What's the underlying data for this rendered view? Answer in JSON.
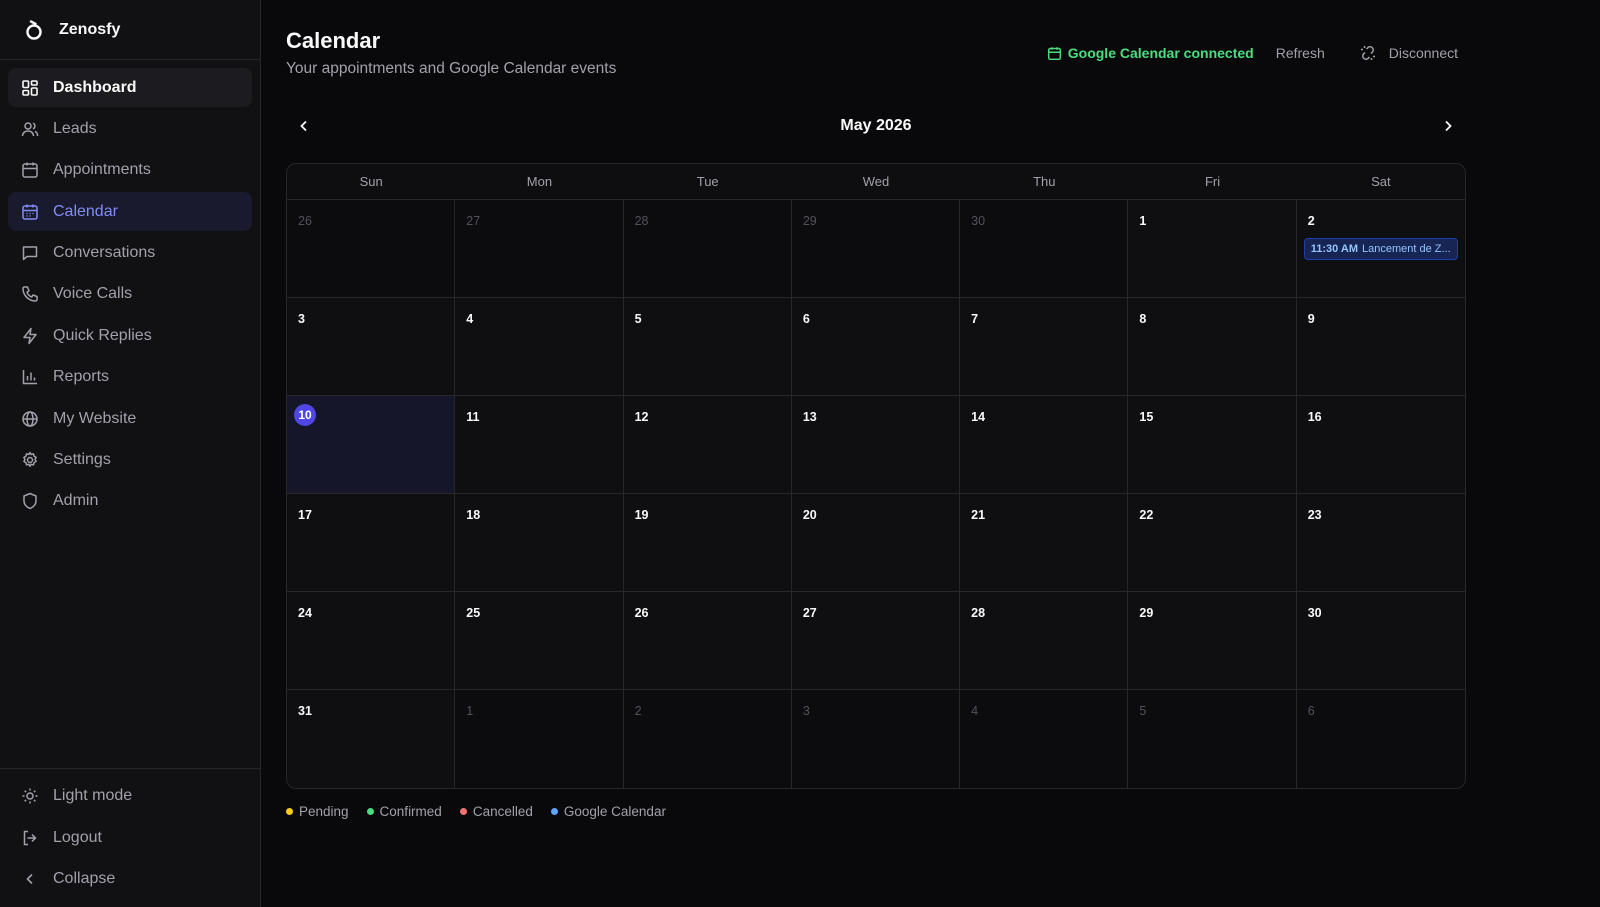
{
  "brand": {
    "name": "Zenosfy"
  },
  "sidebar": {
    "items": [
      {
        "label": "Dashboard",
        "icon": "grid-icon"
      },
      {
        "label": "Leads",
        "icon": "users-icon"
      },
      {
        "label": "Appointments",
        "icon": "calendar-icon"
      },
      {
        "label": "Calendar",
        "icon": "calendar-icon"
      },
      {
        "label": "Conversations",
        "icon": "message-icon"
      },
      {
        "label": "Voice Calls",
        "icon": "phone-icon"
      },
      {
        "label": "Quick Replies",
        "icon": "lightning-icon"
      },
      {
        "label": "Reports",
        "icon": "bar-chart-icon"
      },
      {
        "label": "My Website",
        "icon": "globe-icon"
      },
      {
        "label": "Settings",
        "icon": "gear-icon"
      },
      {
        "label": "Admin",
        "icon": "shield-icon"
      }
    ],
    "bottom": [
      {
        "label": "Light mode",
        "icon": "sun-icon"
      },
      {
        "label": "Logout",
        "icon": "logout-icon"
      },
      {
        "label": "Collapse",
        "icon": "chevron-left-icon"
      }
    ]
  },
  "header": {
    "title": "Calendar",
    "subtitle": "Your appointments and Google Calendar events",
    "gcal_status": "Google Calendar connected",
    "refresh_label": "Refresh",
    "disconnect_label": "Disconnect"
  },
  "calendar": {
    "month_label": "May 2026",
    "weekdays": [
      "Sun",
      "Mon",
      "Tue",
      "Wed",
      "Thu",
      "Fri",
      "Sat"
    ],
    "weeks": [
      [
        "26",
        "27",
        "28",
        "29",
        "30",
        "1",
        "2"
      ],
      [
        "3",
        "4",
        "5",
        "6",
        "7",
        "8",
        "9"
      ],
      [
        "10",
        "11",
        "12",
        "13",
        "14",
        "15",
        "16"
      ],
      [
        "17",
        "18",
        "19",
        "20",
        "21",
        "22",
        "23"
      ],
      [
        "24",
        "25",
        "26",
        "27",
        "28",
        "29",
        "30"
      ],
      [
        "31",
        "1",
        "2",
        "3",
        "4",
        "5",
        "6"
      ]
    ],
    "today": "10",
    "event": {
      "time": "11:30 AM",
      "title": "Lancement de Z..."
    }
  },
  "legend": [
    {
      "label": "Pending",
      "color": "#facc15"
    },
    {
      "label": "Confirmed",
      "color": "#4ade80"
    },
    {
      "label": "Cancelled",
      "color": "#f87171"
    },
    {
      "label": "Google Calendar",
      "color": "#60a5fa"
    }
  ],
  "colors": {
    "accent": "#818cf8",
    "today": "#4f46e5",
    "connected": "#4ade80",
    "event": "#93c5fd"
  }
}
